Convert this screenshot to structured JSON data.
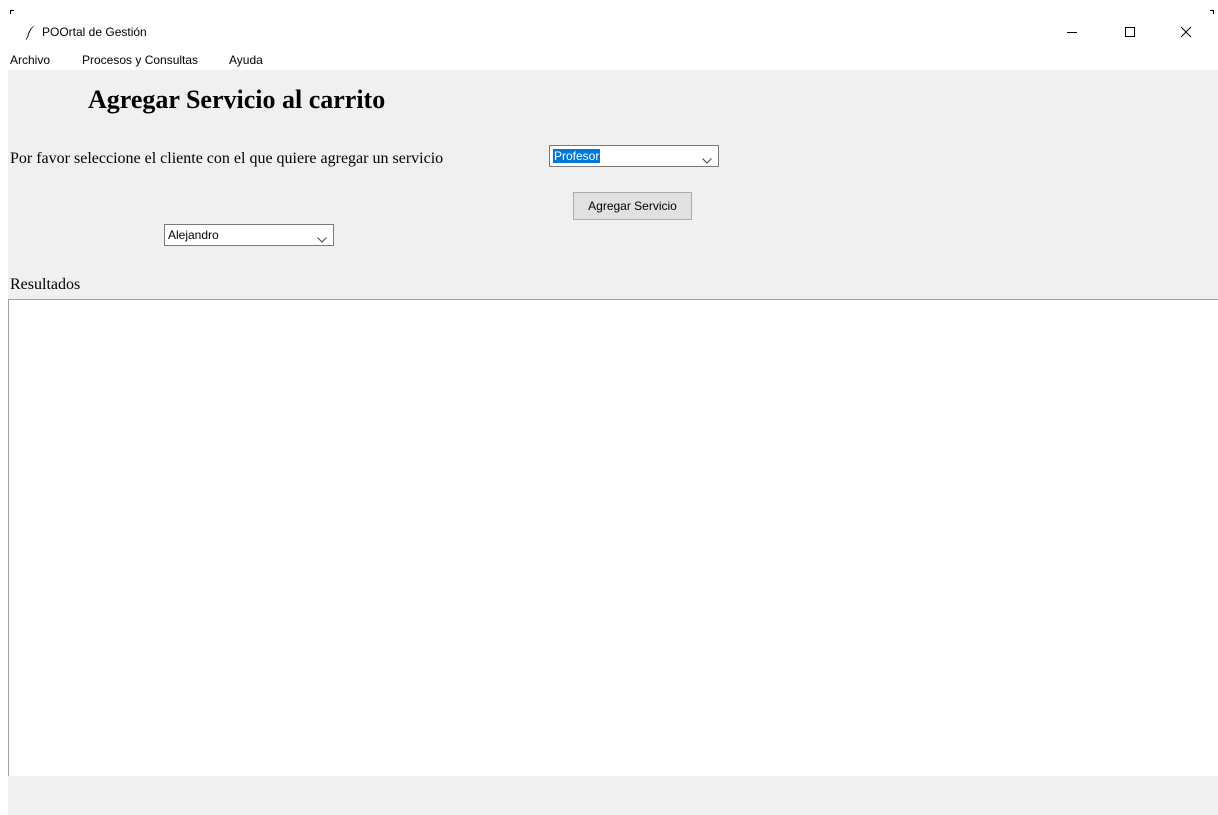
{
  "window": {
    "title": "POOrtal de Gestión",
    "app_icon": "feather-icon",
    "controls": [
      "minimize-icon",
      "maximize-icon",
      "close-icon"
    ]
  },
  "menubar": {
    "items": [
      {
        "label": "Archivo"
      },
      {
        "label": "Procesos y Consultas"
      },
      {
        "label": "Ayuda"
      }
    ]
  },
  "main": {
    "heading": "Agregar Servicio al carrito",
    "prompt": "Por favor seleccione el cliente con el que quiere agregar un servicio",
    "service_select": {
      "value": "Profesor"
    },
    "client_select": {
      "value": "Alejandro"
    },
    "add_button_label": "Agregar Servicio",
    "results_label": "Resultados",
    "results_text": ""
  },
  "colors": {
    "background": "#f0f0f0",
    "selection": "#0078d7"
  }
}
